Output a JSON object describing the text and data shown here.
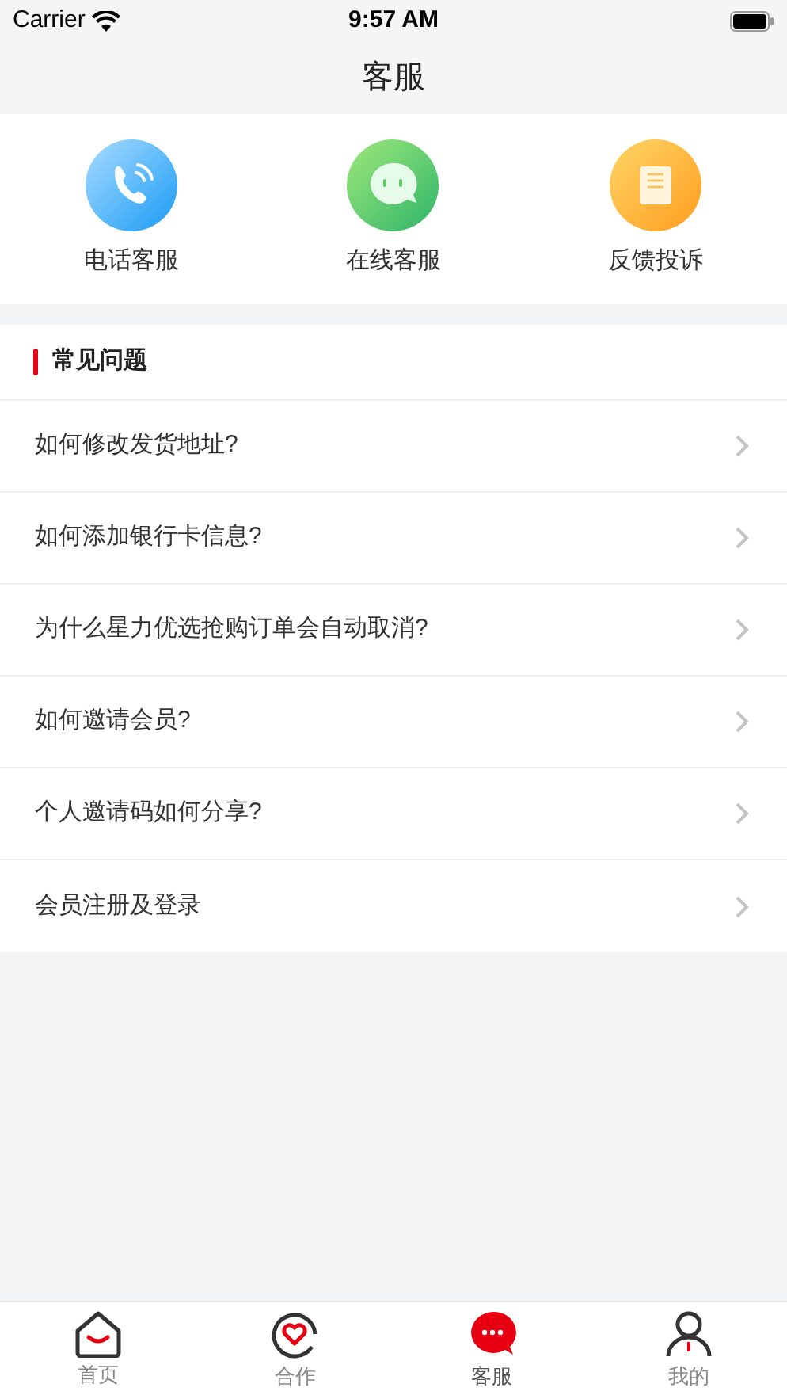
{
  "status_bar": {
    "carrier": "Carrier",
    "time": "9:57 AM"
  },
  "title": "客服",
  "services": [
    {
      "label": "电话客服",
      "kind": "phone"
    },
    {
      "label": "在线客服",
      "kind": "chat"
    },
    {
      "label": "反馈投诉",
      "kind": "feedback"
    }
  ],
  "faq": {
    "title": "常见问题",
    "items": [
      "如何修改发货地址?",
      "如何添加银行卡信息?",
      "为什么星力优选抢购订单会自动取消?",
      "如何邀请会员?",
      "个人邀请码如何分享?",
      "会员注册及登录"
    ]
  },
  "tabs": [
    {
      "label": "首页",
      "kind": "home",
      "selected": false
    },
    {
      "label": "合作",
      "kind": "heart",
      "selected": false
    },
    {
      "label": "客服",
      "kind": "chat",
      "selected": true
    },
    {
      "label": "我的",
      "kind": "person",
      "selected": false
    }
  ]
}
